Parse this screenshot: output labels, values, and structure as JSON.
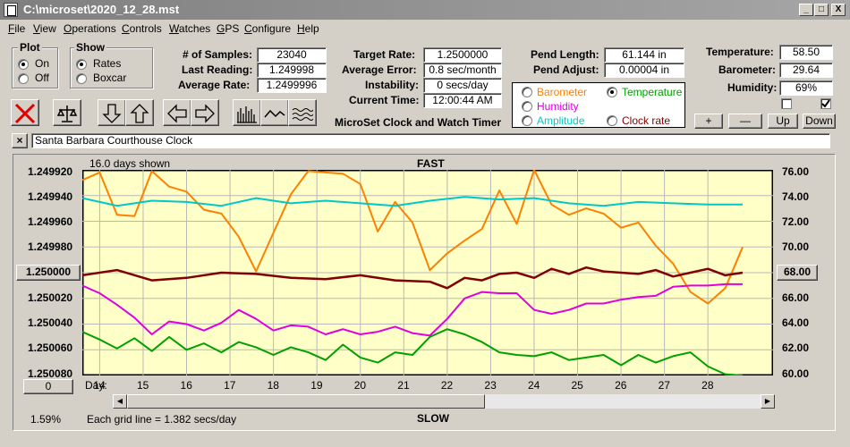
{
  "window": {
    "title": "C:\\microset\\2020_12_28.mst",
    "min": "_",
    "max": "□",
    "close": "X"
  },
  "menu": [
    "File",
    "View",
    "Operations",
    "Controls",
    "Watches",
    "GPS",
    "Configure",
    "Help"
  ],
  "plot": {
    "title": "Plot",
    "on": "On",
    "off": "Off",
    "selected": "On"
  },
  "show": {
    "title": "Show",
    "rates": "Rates",
    "boxcar": "Boxcar",
    "selected": "Rates"
  },
  "stats": {
    "samples_label": "# of Samples:",
    "samples": "23040",
    "last_label": "Last Reading:",
    "last": "1.249998",
    "avg_label": "Average Rate:",
    "avg": "1.2499996"
  },
  "timing": {
    "target_label": "Target Rate:",
    "target": "1.2500000",
    "error_label": "Average Error:",
    "error": "0.8 sec/month",
    "instab_label": "Instability:",
    "instab": "0 secs/day",
    "time_label": "Current Time:",
    "time": "12:00:44 AM",
    "caption": "MicroSet Clock and Watch Timer"
  },
  "pend": {
    "length_label": "Pend Length:",
    "length": "61.144 in",
    "adjust_label": "Pend Adjust:",
    "adjust": "0.00004 in"
  },
  "sensors": {
    "barometer": "Barometer",
    "temperature": "Temperature",
    "humidity": "Humidity",
    "amplitude": "Amplitude",
    "clock_rate": "Clock rate",
    "selected": "Temperature",
    "colors": {
      "barometer": "#ff8000",
      "temperature": "#00a000",
      "humidity": "#e000e0",
      "amplitude": "#00c8c8",
      "clock_rate": "#800000"
    }
  },
  "env": {
    "temp_label": "Temperature:",
    "temp": "58.50",
    "baro_label": "Barometer:",
    "baro": "29.64",
    "hum_label": "Humidity:",
    "hum": "69%",
    "plus": "+",
    "minus": "—",
    "up": "Up",
    "down": "Down"
  },
  "clock_name": "Santa Barbara Courthouse Clock",
  "clear_btn": "×",
  "chart_labels": {
    "days_shown": "16.0 days shown",
    "top": "FAST",
    "bottom": "SLOW",
    "day": "Day:",
    "grid_note": "Each grid line = 1.382 secs/day",
    "percent": "1.59%",
    "zero_btn": "0",
    "left_center": "1.250000",
    "right_center": "68.00"
  },
  "chart_data": {
    "type": "line",
    "x_range": [
      13.6,
      29.5
    ],
    "x_ticks": [
      14,
      15,
      16,
      17,
      18,
      19,
      20,
      21,
      22,
      23,
      24,
      25,
      26,
      27,
      28
    ],
    "y_left_ticks": [
      "1.249920",
      "1.249940",
      "1.249960",
      "1.249980",
      "1.250000",
      "1.250020",
      "1.250040",
      "1.250060",
      "1.250080"
    ],
    "y_left_range": [
      1.24992,
      1.25008
    ],
    "y_right_ticks": [
      "76.00",
      "74.00",
      "72.00",
      "70.00",
      "68.00",
      "66.00",
      "64.00",
      "62.00",
      "60.00"
    ],
    "y_right_range": [
      60,
      76
    ],
    "series": [
      {
        "name": "Barometer",
        "color": "#ff8000",
        "x": [
          13.6,
          14.0,
          14.4,
          14.8,
          15.2,
          15.6,
          16.0,
          16.4,
          16.8,
          17.2,
          17.6,
          18.0,
          18.4,
          18.8,
          19.2,
          19.6,
          20.0,
          20.4,
          20.8,
          21.2,
          21.6,
          22.0,
          22.4,
          22.8,
          23.2,
          23.6,
          24.0,
          24.4,
          24.8,
          25.2,
          25.6,
          26.0,
          26.4,
          26.8,
          27.2,
          27.6,
          28.0,
          28.4,
          28.8
        ],
        "y": [
          75.2,
          75.8,
          72.5,
          72.4,
          75.9,
          74.7,
          74.3,
          72.9,
          72.6,
          70.8,
          68.1,
          71.1,
          74.1,
          75.9,
          75.8,
          75.7,
          74.9,
          71.2,
          73.5,
          71.9,
          68.2,
          69.5,
          70.5,
          71.4,
          74.4,
          71.8,
          76.0,
          73.3,
          72.5,
          73.0,
          72.6,
          71.5,
          71.9,
          70.1,
          68.7,
          66.5,
          65.6,
          66.8,
          70.0
        ]
      },
      {
        "name": "Amplitude",
        "color": "#00c8c8",
        "x": [
          13.6,
          14.4,
          15.2,
          16.0,
          16.8,
          17.6,
          18.4,
          19.2,
          20.0,
          20.8,
          21.6,
          22.4,
          23.2,
          24.0,
          24.8,
          25.6,
          26.4,
          27.2,
          28.0,
          28.8
        ],
        "y": [
          73.8,
          73.2,
          73.6,
          73.5,
          73.2,
          73.8,
          73.4,
          73.6,
          73.4,
          73.2,
          73.6,
          73.9,
          73.7,
          73.8,
          73.4,
          73.2,
          73.5,
          73.4,
          73.3,
          73.3
        ]
      },
      {
        "name": "Clock rate",
        "color": "#800000",
        "x": [
          13.6,
          14.4,
          15.2,
          16.0,
          16.8,
          17.6,
          18.4,
          19.2,
          20.0,
          20.8,
          21.6,
          22.0,
          22.4,
          22.8,
          23.2,
          23.6,
          24.0,
          24.4,
          24.8,
          25.2,
          25.6,
          26.0,
          26.4,
          26.8,
          27.2,
          27.6,
          28.0,
          28.4,
          28.8
        ],
        "y": [
          67.8,
          68.2,
          67.4,
          67.6,
          68.0,
          67.9,
          67.6,
          67.5,
          67.8,
          67.4,
          67.3,
          66.8,
          67.6,
          67.4,
          67.9,
          68.0,
          67.6,
          68.3,
          67.9,
          68.4,
          68.1,
          68.0,
          67.9,
          68.2,
          67.7,
          68.0,
          68.3,
          67.8,
          68.0
        ]
      },
      {
        "name": "Humidity",
        "color": "#e000e0",
        "x": [
          13.6,
          14.0,
          14.4,
          14.8,
          15.2,
          15.6,
          16.0,
          16.4,
          16.8,
          17.2,
          17.6,
          18.0,
          18.4,
          18.8,
          19.2,
          19.6,
          20.0,
          20.4,
          20.8,
          21.2,
          21.6,
          22.0,
          22.4,
          22.8,
          23.2,
          23.6,
          24.0,
          24.4,
          24.8,
          25.2,
          25.6,
          26.0,
          26.4,
          26.8,
          27.2,
          27.6,
          28.0,
          28.4,
          28.8
        ],
        "y": [
          67.0,
          66.4,
          65.5,
          64.5,
          63.2,
          64.2,
          64.0,
          63.5,
          64.1,
          65.1,
          64.4,
          63.5,
          63.9,
          63.8,
          63.2,
          63.6,
          63.2,
          63.4,
          63.8,
          63.3,
          63.1,
          64.4,
          66.0,
          66.5,
          66.4,
          66.4,
          65.1,
          64.8,
          65.1,
          65.6,
          65.6,
          65.9,
          66.1,
          66.2,
          66.9,
          67.0,
          67.0,
          67.1,
          67.1
        ]
      },
      {
        "name": "Temperature",
        "color": "#00a000",
        "x": [
          13.6,
          14.0,
          14.4,
          14.8,
          15.2,
          15.6,
          16.0,
          16.4,
          16.8,
          17.2,
          17.6,
          18.0,
          18.4,
          18.8,
          19.2,
          19.6,
          20.0,
          20.4,
          20.8,
          21.2,
          21.6,
          22.0,
          22.4,
          22.8,
          23.2,
          23.6,
          24.0,
          24.4,
          24.8,
          25.2,
          25.6,
          26.0,
          26.4,
          26.8,
          27.2,
          27.6,
          28.0,
          28.4,
          28.8
        ],
        "y": [
          63.4,
          62.8,
          62.1,
          62.9,
          61.9,
          63.0,
          62.0,
          62.5,
          61.8,
          62.6,
          62.2,
          61.6,
          62.2,
          61.8,
          61.2,
          62.4,
          61.4,
          61.0,
          61.8,
          61.6,
          63.0,
          63.6,
          63.2,
          62.6,
          61.8,
          61.6,
          61.5,
          61.8,
          61.2,
          61.4,
          61.6,
          60.8,
          61.6,
          61.0,
          61.5,
          61.8,
          60.7,
          60.1,
          60.0
        ]
      }
    ]
  }
}
